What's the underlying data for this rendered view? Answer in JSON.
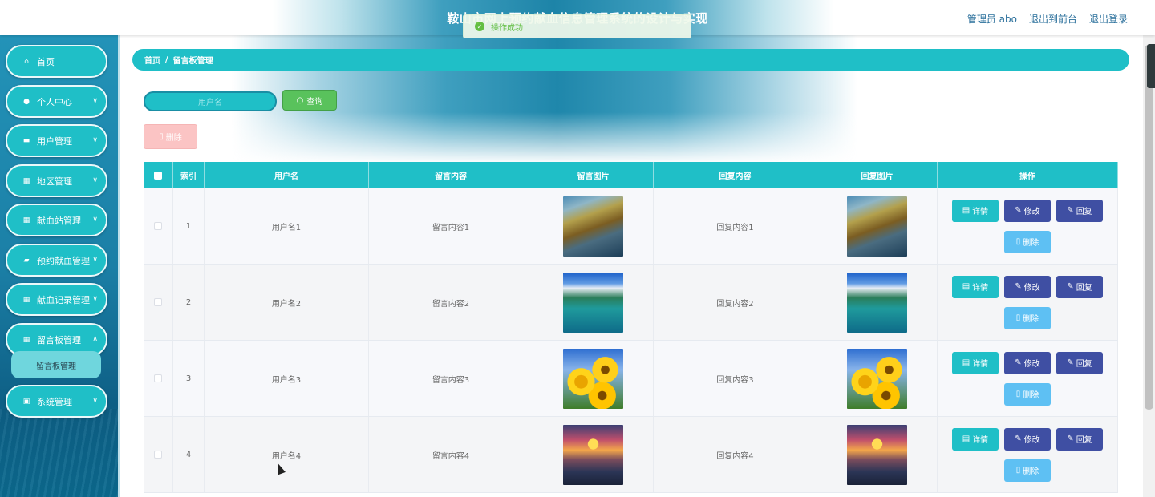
{
  "header": {
    "title": "鞍山市网上预约献血信息管理系统的设计与实现",
    "admin_label": "管理员 abo",
    "back_front_label": "退出到前台",
    "logout_label": "退出登录"
  },
  "toast": {
    "message": "操作成功"
  },
  "sidebar": {
    "items": [
      {
        "label": "首页",
        "icon": "home-icon"
      },
      {
        "label": "个人中心",
        "icon": "user-icon"
      },
      {
        "label": "用户管理",
        "icon": "monitor-icon"
      },
      {
        "label": "地区管理",
        "icon": "grid-icon"
      },
      {
        "label": "献血站管理",
        "icon": "grid-icon"
      },
      {
        "label": "预约献血管理",
        "icon": "chat-icon"
      },
      {
        "label": "献血记录管理",
        "icon": "grid-icon"
      },
      {
        "label": "留言板管理",
        "icon": "grid-icon"
      },
      {
        "label": "系统管理",
        "icon": "clipboard-icon"
      }
    ],
    "active_submenu": "留言板管理"
  },
  "breadcrumb": {
    "home": "首页",
    "separator": "/",
    "current": "留言板管理"
  },
  "search": {
    "placeholder": "用户名",
    "query_label": "查询"
  },
  "bulk_delete_label": "删除",
  "table": {
    "headers": [
      "索引",
      "用户名",
      "留言内容",
      "留言图片",
      "回复内容",
      "回复图片",
      "操作"
    ],
    "rows": [
      {
        "index": "1",
        "username": "用户名1",
        "message": "留言内容1",
        "reply": "回复内容1",
        "image": "road"
      },
      {
        "index": "2",
        "username": "用户名2",
        "message": "留言内容2",
        "reply": "回复内容2",
        "image": "lake"
      },
      {
        "index": "3",
        "username": "用户名3",
        "message": "留言内容3",
        "reply": "回复内容3",
        "image": "flower"
      },
      {
        "index": "4",
        "username": "用户名4",
        "message": "留言内容4",
        "reply": "回复内容4",
        "image": "sunset"
      }
    ],
    "actions": {
      "detail": "详情",
      "edit": "修改",
      "reply": "回复",
      "delete": "删除"
    }
  }
}
